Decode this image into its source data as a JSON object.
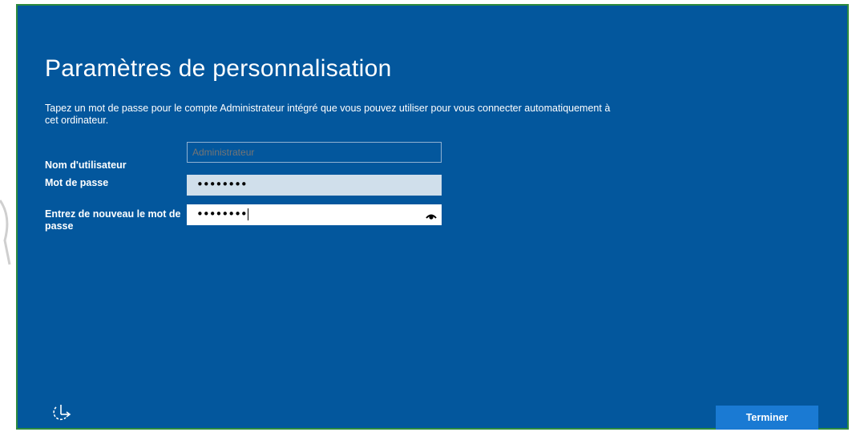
{
  "page": {
    "title": "Paramètres de personnalisation",
    "description": "Tapez un mot de passe pour le compte Administrateur intégré que vous pouvez utiliser pour vous connecter automatiquement à cet ordinateur."
  },
  "form": {
    "username_label": "Nom d'utilisateur",
    "username_placeholder": "Administrateur",
    "password_label": "Mot de passe",
    "password_value": "••••••••",
    "confirm_label": "Entrez de nouveau le mot de passe",
    "confirm_value": "••••••••"
  },
  "footer": {
    "finish_label": "Terminer",
    "ease_of_access_icon": "ease-of-access-icon"
  },
  "colors": {
    "background": "#03579d",
    "button": "#1a7ad3",
    "password_field": "#d0dfeb"
  }
}
